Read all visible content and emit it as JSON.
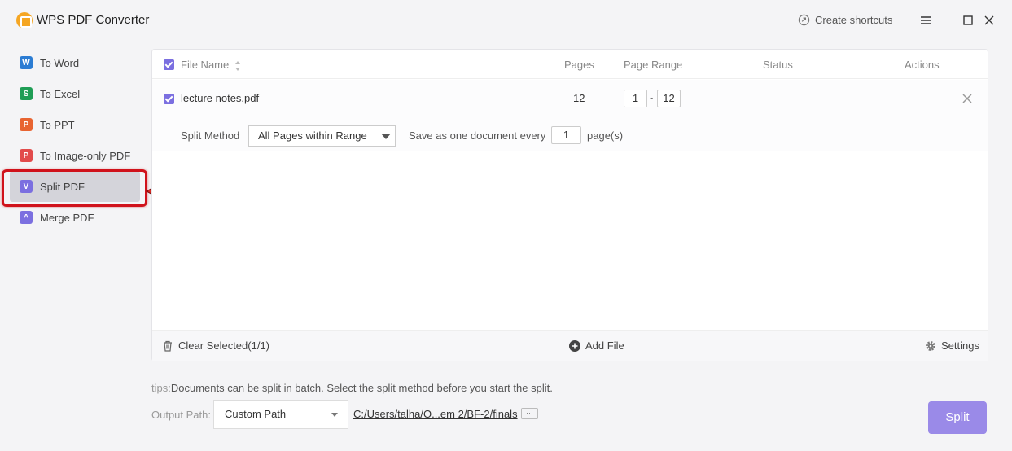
{
  "app": {
    "title": "WPS PDF Converter",
    "create_shortcuts": "Create shortcuts"
  },
  "sidebar": {
    "items": [
      {
        "label": "To Word",
        "icon": "word-icon",
        "color": "#2b7cd3",
        "glyph": "W"
      },
      {
        "label": "To Excel",
        "icon": "excel-icon",
        "color": "#1f9d55",
        "glyph": "S"
      },
      {
        "label": "To PPT",
        "icon": "ppt-icon",
        "color": "#e86431",
        "glyph": "P"
      },
      {
        "label": "To Image-only PDF",
        "icon": "image-pdf-icon",
        "color": "#e24b4b",
        "glyph": "P"
      },
      {
        "label": "Split PDF",
        "icon": "split-pdf-icon",
        "color": "#7b6fe0",
        "glyph": "V"
      },
      {
        "label": "Merge PDF",
        "icon": "merge-pdf-icon",
        "color": "#7b6fe0",
        "glyph": "^"
      }
    ],
    "active": "Split PDF"
  },
  "table": {
    "headers": {
      "file_name": "File Name",
      "pages": "Pages",
      "page_range": "Page Range",
      "status": "Status",
      "actions": "Actions"
    },
    "rows": [
      {
        "file_name": "lecture notes.pdf",
        "pages": "12",
        "range_from": "1",
        "range_sep": "-",
        "range_to": "12"
      }
    ],
    "split": {
      "method_label": "Split Method",
      "method_value": "All Pages within Range",
      "every_label": "Save as one document every",
      "every_value": "1",
      "every_unit": "page(s)"
    }
  },
  "footer": {
    "clear": "Clear Selected(1/1)",
    "add": "Add File",
    "settings": "Settings"
  },
  "tips": {
    "prefix": "tips:",
    "text": "Documents can be split in batch. Select the split method before you start the split."
  },
  "output": {
    "label": "Output Path:",
    "select_value": "Custom Path",
    "path": "C:/Users/talha/O...em 2/BF-2/finals",
    "more": "···"
  },
  "actions": {
    "split": "Split"
  },
  "colors": {
    "accent": "#7b6fe0",
    "split_button": "#9a8ae8",
    "highlight": "#d0121b"
  }
}
